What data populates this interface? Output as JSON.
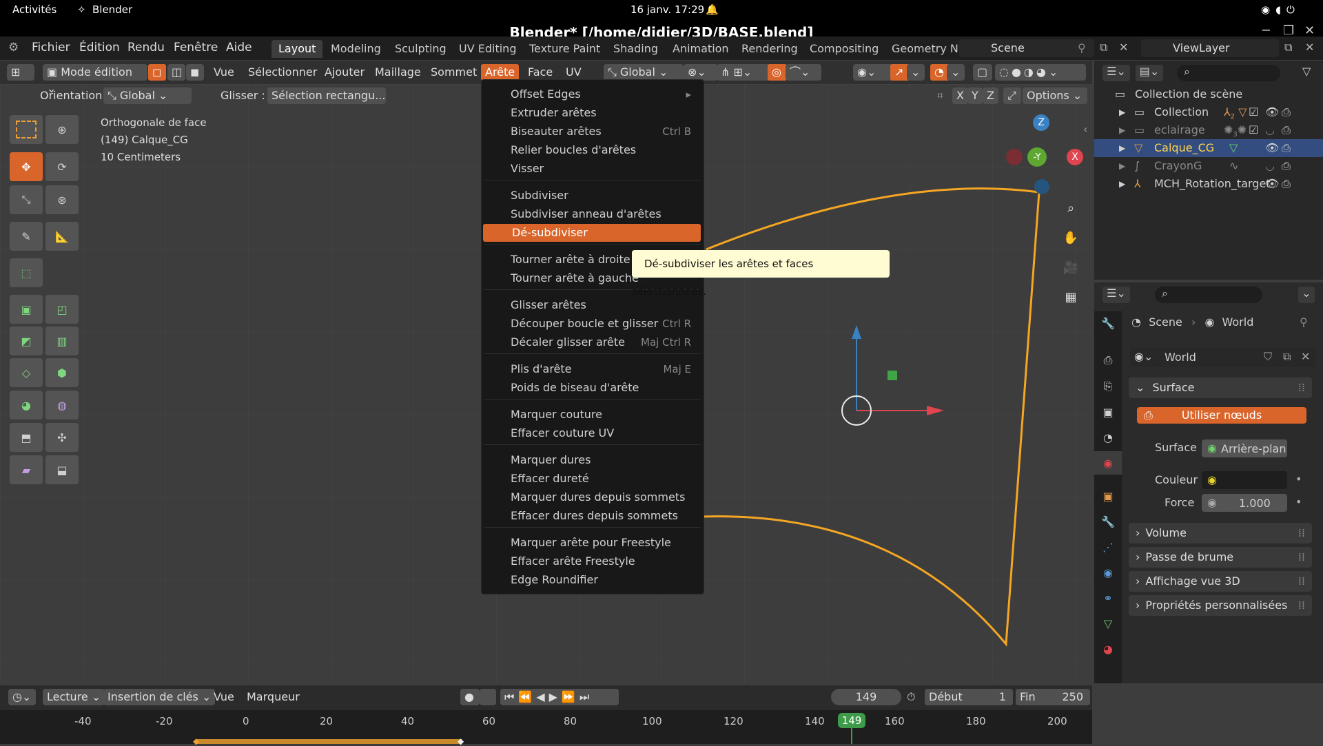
{
  "gnome": {
    "activities": "Activités",
    "app": "Blender",
    "clock": "16 janv.  17:29"
  },
  "window": {
    "title": "Blender* [/home/didier/3D/BASE.blend]"
  },
  "menu": {
    "items": [
      "Fichier",
      "Édition",
      "Rendu",
      "Fenêtre",
      "Aide"
    ]
  },
  "workspaces": [
    "Layout",
    "Modeling",
    "Sculpting",
    "UV Editing",
    "Texture Paint",
    "Shading",
    "Animation",
    "Rendering",
    "Compositing",
    "Geometry N"
  ],
  "scene": {
    "label": "Scene",
    "viewlayer": "ViewLayer"
  },
  "header": {
    "mode": "Mode édition",
    "menus": [
      "Vue",
      "Sélectionner",
      "Ajouter",
      "Maillage",
      "Sommet",
      "Arête",
      "Face",
      "UV"
    ],
    "transform": "Global"
  },
  "tool_options": {
    "orientation_label": "Orientation:",
    "orientation_value": "Global",
    "drag_label": "Glisser :",
    "drag_value": "Sélection rectangu...",
    "options": "Options",
    "axes": [
      "X",
      "Y",
      "Z"
    ]
  },
  "viewport_info": {
    "line1": "Orthogonale de face",
    "line2": "(149) Calque_CG",
    "line3": "10 Centimeters"
  },
  "gizmo": {
    "z": "Z",
    "y": "-Y",
    "x": "X"
  },
  "edge_menu": {
    "groups": [
      [
        {
          "label": "Offset Edges",
          "shortcut": "▸"
        },
        {
          "label": "Extruder arêtes",
          "shortcut": ""
        },
        {
          "label": "Biseauter arêtes",
          "shortcut": "Ctrl B"
        },
        {
          "label": "Relier boucles d'arêtes",
          "shortcut": ""
        },
        {
          "label": "Visser",
          "shortcut": ""
        }
      ],
      [
        {
          "label": "Subdiviser",
          "shortcut": ""
        },
        {
          "label": "Subdiviser anneau d'arêtes",
          "shortcut": ""
        },
        {
          "label": "Dé-subdiviser",
          "shortcut": ""
        }
      ],
      [
        {
          "label": "Tourner arête à droite",
          "shortcut": ""
        },
        {
          "label": "Tourner arête à gauche",
          "shortcut": ""
        }
      ],
      [
        {
          "label": "Glisser arêtes",
          "shortcut": ""
        },
        {
          "label": "Découper boucle et glisser",
          "shortcut": "Ctrl R"
        },
        {
          "label": "Décaler glisser arête",
          "shortcut": "Maj Ctrl R"
        }
      ],
      [
        {
          "label": "Plis d'arête",
          "shortcut": "Maj E"
        },
        {
          "label": "Poids de biseau d'arête",
          "shortcut": ""
        }
      ],
      [
        {
          "label": "Marquer couture",
          "shortcut": ""
        },
        {
          "label": "Effacer couture UV",
          "shortcut": ""
        }
      ],
      [
        {
          "label": "Marquer dures",
          "shortcut": ""
        },
        {
          "label": "Effacer dureté",
          "shortcut": ""
        },
        {
          "label": "Marquer dures depuis sommets",
          "shortcut": ""
        },
        {
          "label": "Effacer dures depuis sommets",
          "shortcut": ""
        }
      ],
      [
        {
          "label": "Marquer arête pour Freestyle",
          "shortcut": ""
        },
        {
          "label": "Effacer arête Freestyle",
          "shortcut": ""
        },
        {
          "label": "Edge Roundifier",
          "shortcut": ""
        }
      ]
    ],
    "hovered": "Dé-subdiviser",
    "tooltip": "Dé-subdiviser les arêtes et faces sélectionnées."
  },
  "outliner": {
    "root": "Collection de scène",
    "items": [
      {
        "name": "Collection",
        "count": "2"
      },
      {
        "name": "eclairage",
        "count": "3"
      },
      {
        "name": "Calque_CG",
        "count": ""
      },
      {
        "name": "CrayonG",
        "count": ""
      },
      {
        "name": "MCH_Rotation_target",
        "count": ""
      }
    ]
  },
  "properties": {
    "breadcrumb": [
      "Scene",
      "World"
    ],
    "world_name": "World",
    "surface_header": "Surface",
    "use_nodes": "Utiliser nœuds",
    "surface_label": "Surface",
    "surface_value": "Arrière-plan",
    "color_label": "Couleur",
    "strength_label": "Force",
    "strength_value": "1.000",
    "panels": [
      "Volume",
      "Passe de brume",
      "Affichage vue 3D",
      "Propriétés personnalisées"
    ]
  },
  "timeline": {
    "playback": "Lecture",
    "keying": "Insertion de clés",
    "view": "Vue",
    "marker": "Marqueur",
    "current_frame": "149",
    "start_label": "Début",
    "start": "1",
    "end_label": "Fin",
    "end": "250",
    "ticks": [
      "-40",
      "-20",
      "0",
      "20",
      "40",
      "60",
      "80",
      "100",
      "120",
      "140",
      "149",
      "160",
      "180",
      "200"
    ]
  },
  "colors": {
    "accent": "#d9652b",
    "selected_edge": "#f5a623",
    "axis_x": "#e0444f",
    "axis_y": "#5ea832",
    "axis_z": "#3b82c4"
  }
}
